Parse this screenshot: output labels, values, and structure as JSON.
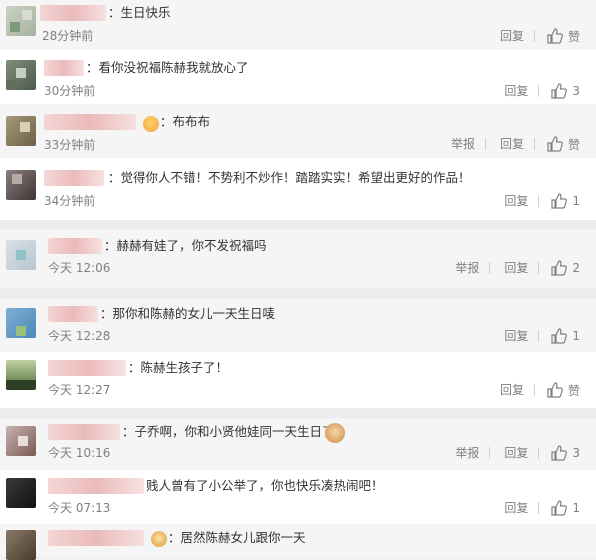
{
  "comments": [
    {
      "text": "：生日快乐",
      "time": "28分钟前",
      "report": "",
      "reply": "回复",
      "like": "赞",
      "count": ""
    },
    {
      "text": "：看你没祝福陈赫我就放心了",
      "time": "30分钟前",
      "report": "",
      "reply": "回复",
      "like": "",
      "count": "3"
    },
    {
      "text": "：布布布",
      "time": "33分钟前",
      "report": "举报",
      "reply": "回复",
      "like": "赞",
      "count": ""
    },
    {
      "text": "：觉得你人不错！不势利不炒作！踏踏实实！希望出更好的作品！",
      "time": "34分钟前",
      "report": "",
      "reply": "回复",
      "like": "",
      "count": "1"
    },
    {
      "text": "：赫赫有娃了，你不发祝福吗",
      "time": "今天 12:06",
      "report": "举报",
      "reply": "回复",
      "like": "",
      "count": "2"
    },
    {
      "text": "：那你和陈赫的女儿一天生日唛",
      "time": "今天 12:28",
      "report": "",
      "reply": "回复",
      "like": "",
      "count": "1"
    },
    {
      "text": "：陈赫生孩子了！",
      "time": "今天 12:27",
      "report": "",
      "reply": "回复",
      "like": "赞",
      "count": ""
    },
    {
      "text": "：子乔啊，你和小贤他娃同一天生日了",
      "time": "今天 10:16",
      "report": "举报",
      "reply": "回复",
      "like": "",
      "count": "3"
    },
    {
      "text": "贱人曾有了小公举了，你也快乐凑热闹吧！",
      "time": "今天 07:13",
      "report": "",
      "reply": "回复",
      "like": "",
      "count": "1"
    },
    {
      "text": "：居然陈赫女儿跟你一天",
      "time": "",
      "report": "",
      "reply": "",
      "like": "",
      "count": ""
    }
  ],
  "colors": {
    "text": "#333333",
    "meta": "#808080",
    "username_blur": "#e9b3b3"
  }
}
